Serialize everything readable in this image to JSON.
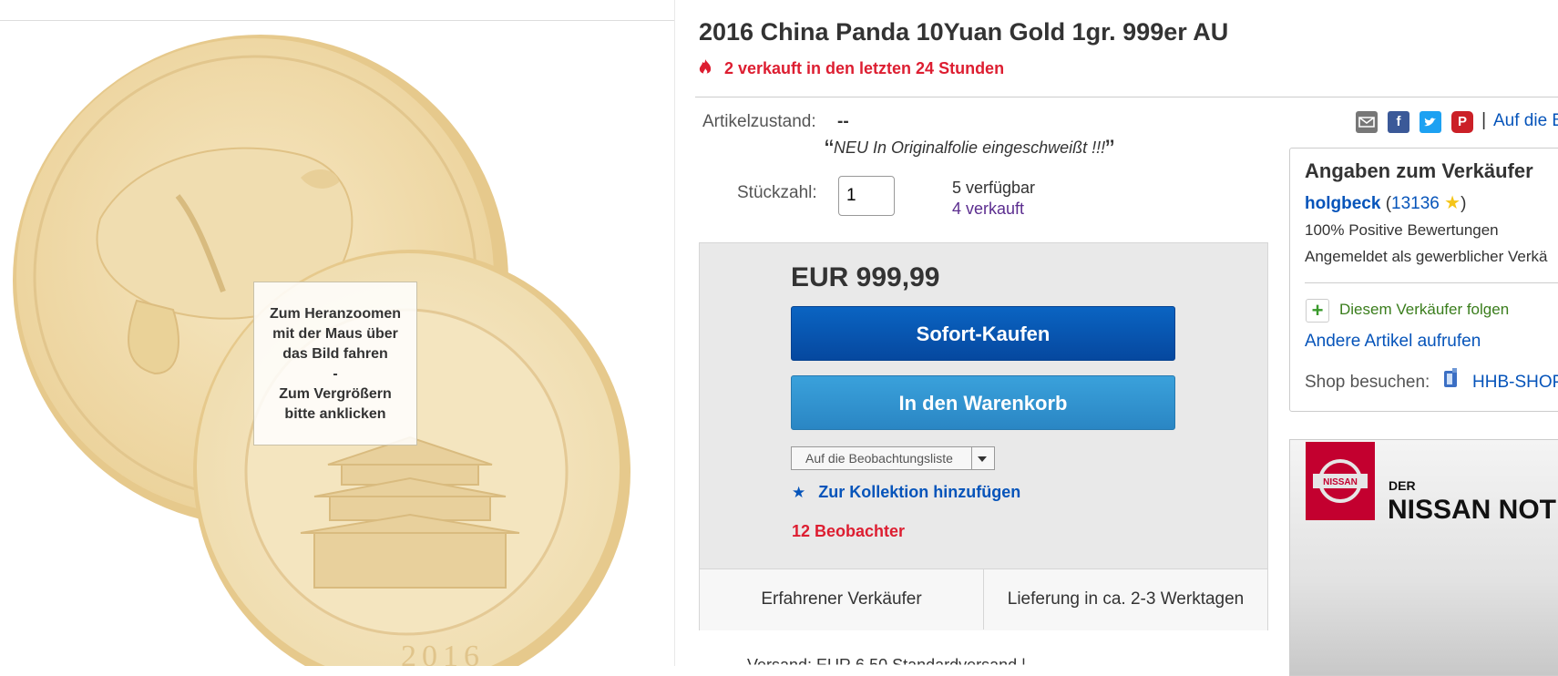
{
  "image": {
    "zoom_hint_lines": [
      "Zum Heranzoomen",
      "mit der Maus über",
      "das Bild fahren",
      "-",
      "Zum Vergrößern",
      "bitte anklicken"
    ],
    "coin_inscription_year": "2016"
  },
  "listing": {
    "title": "2016 China Panda 10Yuan Gold 1gr. 999er AU",
    "sold_recent": "2 verkauft in den letzten 24 Stunden",
    "condition_label": "Artikelzustand:",
    "condition_value": "--",
    "condition_note": "NEU In Originalfolie eingeschweißt !!!",
    "quantity_label": "Stückzahl:",
    "quantity_value": "1",
    "available": "5 verfügbar",
    "sold": "4 verkauft"
  },
  "buybox": {
    "price": "EUR 999,99",
    "buy_now": "Sofort-Kaufen",
    "add_to_cart": "In den Warenkorb",
    "watchlist": "Auf die Beobachtungsliste",
    "collection": "Zur Kollektion hinzufügen",
    "watchers": "12 Beobachter",
    "feature_1": "Erfahrener Verkäufer",
    "feature_2": "Lieferung in ca. 2-3 Werktagen"
  },
  "shipping_partial": "Versand:  EUR 6,50  Standardversand | ...",
  "share": {
    "separator": "|",
    "watch_link": "Auf die B"
  },
  "seller": {
    "heading": "Angaben zum Verkäufer",
    "name": "holgbeck",
    "feedback_count": "13136",
    "open_paren": "(",
    "close_paren": ")",
    "positive": "100% Positive Bewertungen",
    "registered": "Angemeldet als gewerblicher Verkä",
    "follow": "Diesem Verkäufer folgen",
    "other_items": "Andere Artikel aufrufen",
    "shop_label": "Shop besuchen:",
    "shop_name": "HHB-SHOP"
  },
  "ad": {
    "logo": "NISSAN",
    "small_text": "DER",
    "big_text": "NISSAN NOT"
  },
  "colors": {
    "buy_now": "#0654ba",
    "add_cart": "#3498d8",
    "alert_red": "#dd1e31",
    "link_blue": "#0654ba",
    "sold_purple": "#5b2d8f",
    "nissan_red": "#c3002f"
  }
}
